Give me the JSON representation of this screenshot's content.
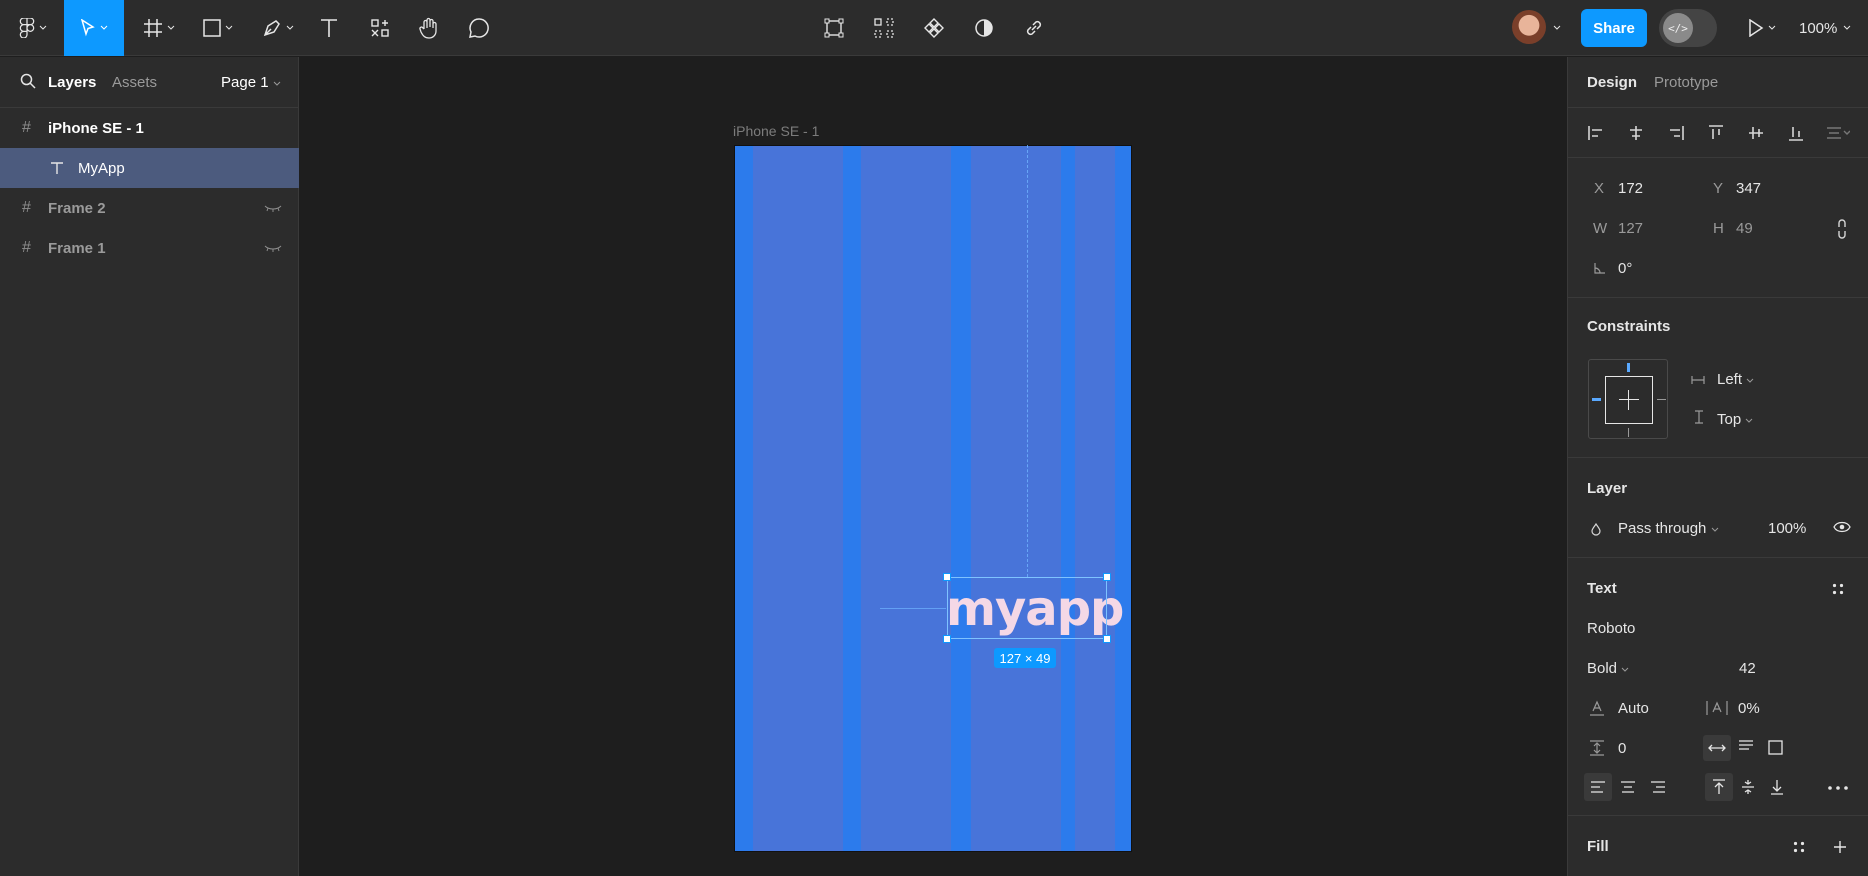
{
  "toolbar": {
    "tools": [
      "figma-menu",
      "move",
      "frame",
      "shape",
      "pen",
      "text",
      "resources",
      "hand",
      "comment"
    ],
    "center_tools": [
      "transform",
      "grid-pattern",
      "component",
      "contrast",
      "link"
    ],
    "share_label": "Share",
    "dev_mode_label": "</>",
    "zoom": "100%",
    "accent_color": "#0d99ff"
  },
  "left_panel": {
    "tabs": {
      "layers": "Layers",
      "assets": "Assets"
    },
    "page": "Page 1",
    "layers": [
      {
        "name": "iPhone SE - 1",
        "type": "frame",
        "selected": false
      },
      {
        "name": "MyApp",
        "type": "text",
        "selected": true
      },
      {
        "name": "Frame 2",
        "type": "frame",
        "hidden": true
      },
      {
        "name": "Frame 1",
        "type": "frame",
        "hidden": true
      }
    ]
  },
  "canvas": {
    "frame_label": "iPhone SE - 1",
    "text_content": "myapp",
    "size_badge": "127 × 49",
    "frame_color": "#2c7bec",
    "column_color": "#4a74d8",
    "text_color": "#f4d8e6"
  },
  "right_panel": {
    "tabs": {
      "design": "Design",
      "prototype": "Prototype"
    },
    "position": {
      "x_label": "X",
      "x": "172",
      "y_label": "Y",
      "y": "347",
      "w_label": "W",
      "w": "127",
      "h_label": "H",
      "h": "49",
      "rotation": "0°"
    },
    "constraints": {
      "title": "Constraints",
      "horizontal": "Left",
      "vertical": "Top"
    },
    "layer": {
      "title": "Layer",
      "blend": "Pass through",
      "opacity": "100%"
    },
    "text": {
      "title": "Text",
      "font": "Roboto",
      "weight": "Bold",
      "size": "42",
      "line_height": "Auto",
      "letter_spacing": "0%",
      "paragraph_spacing": "0"
    },
    "fill": {
      "title": "Fill"
    }
  }
}
